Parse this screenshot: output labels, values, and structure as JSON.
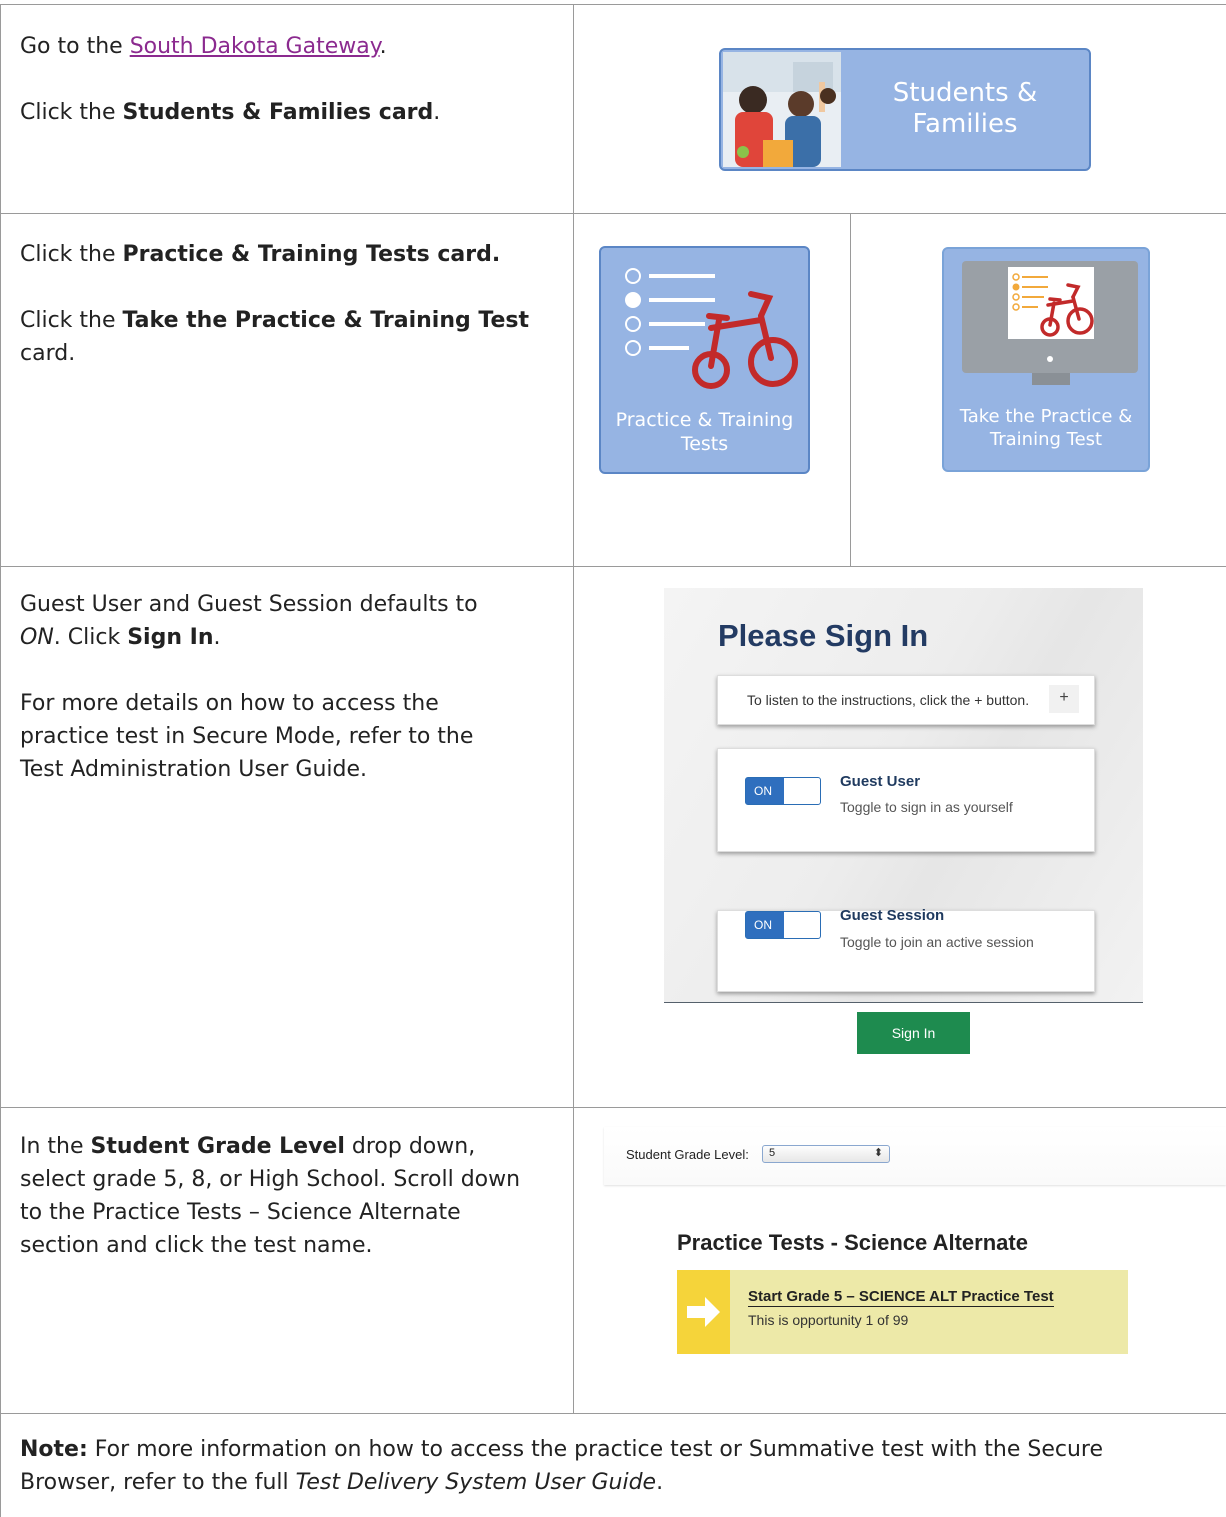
{
  "rows": [
    {
      "instruction_parts": {
        "goto_prefix": "Go to the ",
        "goto_link": "South Dakota Gateway",
        "goto_suffix": ".",
        "click_prefix": "Click the ",
        "click_bold": "Students & Families card",
        "click_suffix": "."
      },
      "card": {
        "label_line1": "Students &",
        "label_line2": "Families"
      }
    },
    {
      "instruction_parts": {
        "line1_prefix": "Click the ",
        "line1_bold": "Practice & Training Tests card.",
        "line2_prefix": "Click the ",
        "line2_bold": "Take the Practice & Training Test",
        "line2_suffix": "card."
      },
      "card_left": {
        "label_line1": "Practice & Training",
        "label_line2": "Tests"
      },
      "card_right": {
        "label_line1": "Take the Practice &",
        "label_line2": "Training Test"
      }
    },
    {
      "instruction_parts": {
        "p1_a": "Guest User and Guest Session defaults to",
        "p1_italic": "ON",
        "p1_b": ". Click ",
        "p1_bold": "Sign In",
        "p1_c": ".",
        "p2_l1": "For more details on how to access the",
        "p2_l2": "practice test in Secure Mode, refer to the",
        "p2_l3": "Test Administration User Guide."
      },
      "signin": {
        "heading": "Please Sign In",
        "listen_text": "To listen to the instructions, click the + button.",
        "plus": "+",
        "guest_user_toggle": "ON",
        "guest_user_title": "Guest User",
        "guest_user_sub": "Toggle to sign in as yourself",
        "guest_session_toggle": "ON",
        "guest_session_title": "Guest Session",
        "guest_session_sub": "Toggle to join an active session",
        "button": "Sign In"
      }
    },
    {
      "instruction_parts": {
        "l1_prefix": "In the ",
        "l1_bold": "Student Grade Level",
        "l1_suffix": " drop down,",
        "l2": "select grade 5, 8, or High School. Scroll down",
        "l3": "to the Practice Tests – Science Alternate",
        "l4": "section and click the test name."
      },
      "grade": {
        "label": "Student Grade Level:",
        "selected": "5",
        "section_title": "Practice Tests - Science Alternate",
        "test_name": "Start Grade 5 – SCIENCE ALT Practice Test",
        "opportunity": "This is opportunity 1 of 99"
      }
    }
  ],
  "note": {
    "bold": "Note:",
    "text_a": " For more information on how to access the practice test or Summative test with the Secure",
    "text_b_prefix": "Browser, refer to the full ",
    "text_b_italic": "Test Delivery System User Guide",
    "text_b_suffix": "."
  },
  "colors": {
    "card": "#96b4e3",
    "link": "#8b2a8f",
    "signin_button": "#1e8b4f",
    "toggle_on": "#2f6fbe",
    "test_row": "#ede9a8",
    "test_arrow": "#f5d43a"
  }
}
